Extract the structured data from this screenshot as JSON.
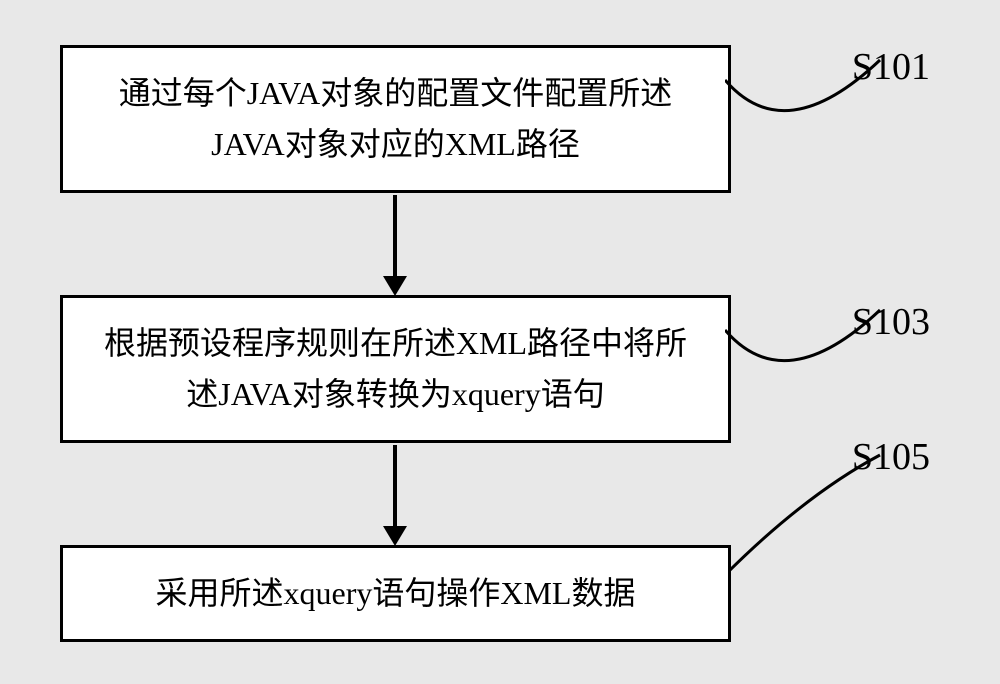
{
  "chart_data": {
    "type": "diagram",
    "title": "",
    "nodes": [
      {
        "id": "S101",
        "label": "S101",
        "text": "通过每个JAVA对象的配置文件配置所述JAVA对象对应的XML路径"
      },
      {
        "id": "S103",
        "label": "S103",
        "text": "根据预设程序规则在所述XML路径中将所述JAVA对象转换为xquery语句"
      },
      {
        "id": "S105",
        "label": "S105",
        "text": "采用所述xquery语句操作XML数据"
      }
    ],
    "edges": [
      {
        "from": "S101",
        "to": "S103"
      },
      {
        "from": "S103",
        "to": "S105"
      }
    ]
  },
  "boxes": {
    "b1": "通过每个JAVA对象的配置文件配置所述JAVA对象对应的XML路径",
    "b2": "根据预设程序规则在所述XML路径中将所述JAVA对象转换为xquery语句",
    "b3": "采用所述xquery语句操作XML数据"
  },
  "labels": {
    "l1": "S101",
    "l2": "S103",
    "l3": "S105"
  }
}
